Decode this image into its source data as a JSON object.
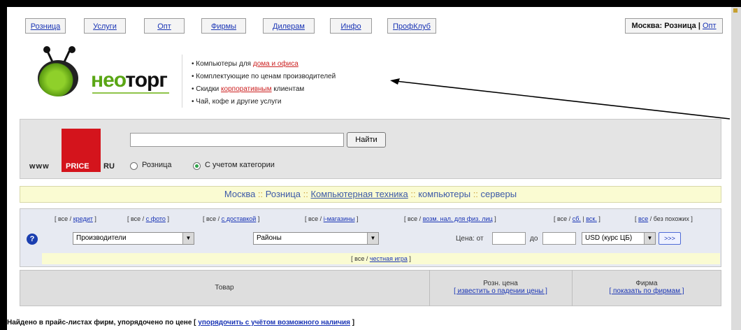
{
  "nav": {
    "buttons": [
      "Розница",
      "Услуги",
      "Опт",
      "Фирмы",
      "Дилерам",
      "Инфо",
      "ПрофКлуб"
    ],
    "region_text": "Москва: Розница",
    "region_sep": " | ",
    "region_link": "Опт"
  },
  "logo": {
    "text_part1": "нео",
    "text_part2": "торг"
  },
  "promo": {
    "l1_pre": "• Компьютеры для ",
    "l1_link": "дома и офиса",
    "l2": "• Комплектующие по ценам производителей",
    "l3_pre": "• Скидки ",
    "l3_link": "корпоративным",
    "l3_post": " клиентам",
    "l4": "• Чай, кофе и другие услуги"
  },
  "price_ru": {
    "www": "www",
    "price": "PRICE",
    "ru": "RU"
  },
  "search": {
    "input_value": "",
    "button_label": "Найти",
    "radio_retail": "Розница",
    "radio_category": "С учетом категории",
    "selected": "category"
  },
  "breadcrumb": {
    "items": [
      "Москва",
      "Розница",
      "Компьютерная техника",
      "компьютеры",
      "серверы"
    ],
    "separator": " :: "
  },
  "filters": {
    "credit": {
      "pre": "[ все / ",
      "link": "кредит",
      "post": " ]"
    },
    "photo": {
      "pre": "[ все / ",
      "link": "с фото",
      "post": " ]"
    },
    "delivery": {
      "pre": "[ все / ",
      "link": "с доставкой",
      "post": " ]"
    },
    "eshops": {
      "pre": "[ все / ",
      "link": "i-магазины",
      "post": " ]"
    },
    "cashless": {
      "pre": "[ все / ",
      "link": "возм. нал. для физ. лиц",
      "post": " ]"
    },
    "days_pre": "[ все / ",
    "days_sat": "сб.",
    "days_sep": " | ",
    "days_sun": "вск.",
    "days_post": " ]",
    "similar_pre": "[ ",
    "similar_link": "все",
    "similar_post": " / без похожих ]",
    "manufacturers": "Производители",
    "districts": "Районы",
    "price_from_label": "Цена: от",
    "price_to_label": "до",
    "currency": "USD (курс ЦБ)",
    "go_label": ">>>",
    "fair_pre": "[ все / ",
    "fair_link": "честная игра",
    "fair_post": " ]"
  },
  "table": {
    "col_product": "Товар",
    "col_price": "Розн. цена",
    "col_price_link": "[ известить о падении цены ]",
    "col_firm": "Фирма",
    "col_firm_link": "[ показать по фирмам ]"
  },
  "status": {
    "found_text": "Найдено в прайс-листах фирм, упорядочено по цене [ ",
    "found_link": "упорядочить с учётом возможного наличия",
    "found_post": " ]"
  },
  "colors": {
    "accent_red": "#d4141c",
    "link_blue": "#1a35b5",
    "logo_green": "#5aa615",
    "highlight_yellow": "#fafbd2"
  }
}
